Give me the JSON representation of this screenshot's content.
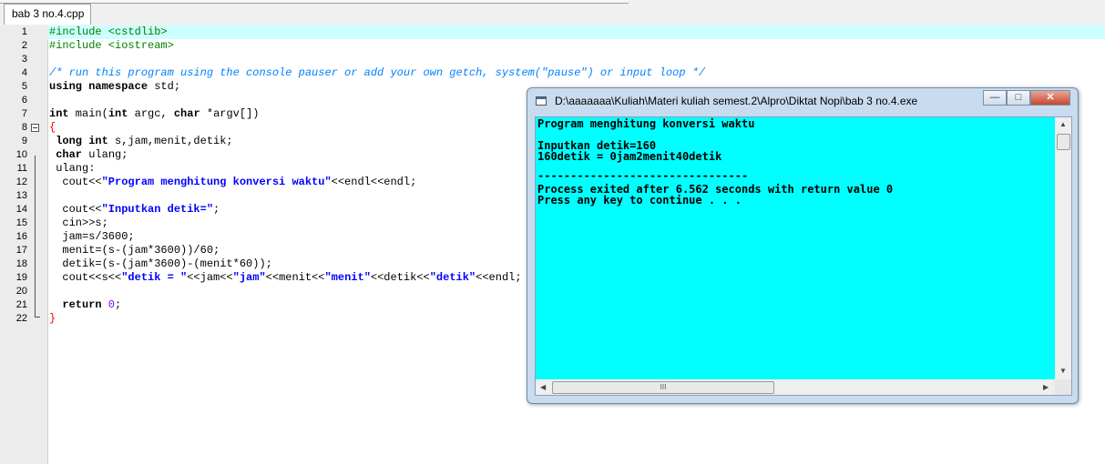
{
  "editor": {
    "tab_label": "bab 3 no.4.cpp",
    "line_numbers": [
      "1",
      "2",
      "3",
      "4",
      "5",
      "6",
      "7",
      "8",
      "9",
      "10",
      "11",
      "12",
      "13",
      "14",
      "15",
      "16",
      "17",
      "18",
      "19",
      "20",
      "21",
      "22"
    ]
  },
  "code": {
    "l1": "#include <cstdlib>",
    "l2": "#include <iostream>",
    "l4": "/* run this program using the console pauser or add your own getch, system(\"pause\") or input loop */",
    "l5_kw": "using namespace",
    "l5_rest": " std;",
    "l7_a": "int",
    "l7_b": " main(",
    "l7_c": "int",
    "l7_d": " argc, ",
    "l7_e": "char",
    "l7_f": " *argv[])",
    "l8": "{",
    "l9_kw": " long int",
    "l9_rest": " s,jam,menit,detik;",
    "l10_kw": " char",
    "l10_rest": " ulang;",
    "l11": " ulang:",
    "l12_a": "  cout<<",
    "l12_b": "\"Program menghitung konversi waktu\"",
    "l12_c": "<<endl<<endl;",
    "l14_a": "  cout<<",
    "l14_b": "\"Inputkan detik=\"",
    "l14_c": ";",
    "l15": "  cin>>s;",
    "l16": "  jam=s/3600;",
    "l17": "  menit=(s-(jam*3600))/60;",
    "l18": "  detik=(s-(jam*3600)-(menit*60));",
    "l19_a": "  cout<<s<<",
    "l19_b": "\"detik = \"",
    "l19_c": "<<jam<<",
    "l19_d": "\"jam\"",
    "l19_e": "<<menit<<",
    "l19_f": "\"menit\"",
    "l19_g": "<<detik<<",
    "l19_h": "\"detik\"",
    "l19_i": "<<endl;",
    "l21_kw": "  return",
    "l21_num": " 0",
    "l21_end": ";",
    "l22": "}"
  },
  "console": {
    "title": "D:\\aaaaaaa\\Kuliah\\Materi kuliah semest.2\\Alpro\\Diktat Nopi\\bab 3 no.4.exe",
    "minimize": "—",
    "maximize": "□",
    "close": "✕",
    "lines": [
      "Program menghitung konversi waktu",
      "",
      "Inputkan detik=160",
      "160detik = 0jam2menit40detik",
      "",
      "--------------------------------",
      "Process exited after 6.562 seconds with return value 0",
      "Press any key to continue . . ."
    ],
    "hscroll_grip": "III",
    "background": "#00ffff"
  }
}
